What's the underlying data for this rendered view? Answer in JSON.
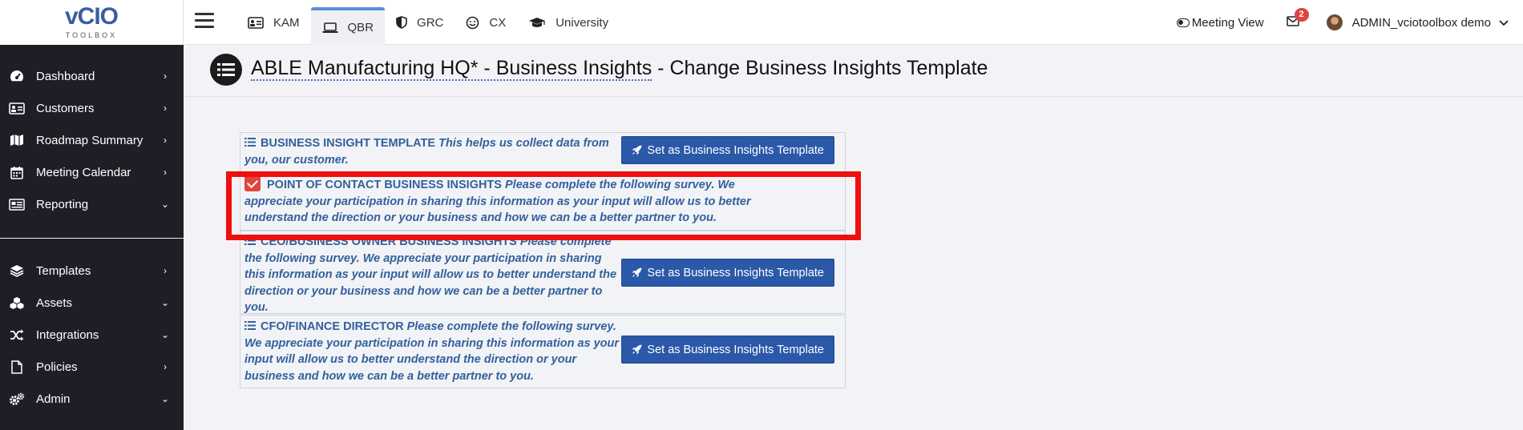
{
  "logo": {
    "main": "vCIO",
    "sub": "TOOLBOX"
  },
  "sidebar": {
    "items": [
      {
        "label": "Dashboard",
        "icon": "dashboard-icon",
        "chevron": "right"
      },
      {
        "label": "Customers",
        "icon": "id-card-icon",
        "chevron": "right"
      },
      {
        "label": "Roadmap Summary",
        "icon": "map-icon",
        "chevron": "right"
      },
      {
        "label": "Meeting Calendar",
        "icon": "calendar-icon",
        "chevron": "right"
      },
      {
        "label": "Reporting",
        "icon": "report-icon",
        "chevron": "down"
      },
      {
        "label": "Templates",
        "icon": "layers-icon",
        "chevron": "right"
      },
      {
        "label": "Assets",
        "icon": "cubes-icon",
        "chevron": "down"
      },
      {
        "label": "Integrations",
        "icon": "shuffle-icon",
        "chevron": "down"
      },
      {
        "label": "Policies",
        "icon": "file-icon",
        "chevron": "right"
      },
      {
        "label": "Admin",
        "icon": "gears-icon",
        "chevron": "down"
      }
    ]
  },
  "topbar": {
    "tabs": [
      {
        "label": "KAM",
        "icon": "id-card-icon",
        "active": false
      },
      {
        "label": "QBR",
        "icon": "laptop-icon",
        "active": true
      },
      {
        "label": "GRC",
        "icon": "shield-icon",
        "active": false
      },
      {
        "label": "CX",
        "icon": "smile-icon",
        "active": false
      },
      {
        "label": "University",
        "icon": "graduation-cap-icon",
        "active": false
      }
    ],
    "meeting_view": "Meeting View",
    "mail_badge": "2",
    "user_name": "ADMIN_vciotoolbox demo"
  },
  "page": {
    "title_link": "ABLE Manufacturing HQ* - Business Insights",
    "title_rest": " - Change Business Insights Template"
  },
  "templates": [
    {
      "name": "BUSINESS INSIGHT TEMPLATE",
      "desc": "This helps us collect data from you, our customer.",
      "button": "Set as Business Insights Template",
      "selected": false
    },
    {
      "name": "POINT OF CONTACT BUSINESS INSIGHTS",
      "desc": "Please complete the following survey. We appreciate your participation in sharing this information as your input will allow us to better understand the direction or your business and how we can be a better partner to you.",
      "button": "",
      "selected": true
    },
    {
      "name": "CEO/BUSINESS OWNER BUSINESS INSIGHTS",
      "desc": "Please complete the following survey. We appreciate your participation in sharing this information as your input will allow us to better understand the direction or your business and how we can be a better partner to you.",
      "button": "Set as Business Insights Template",
      "selected": false
    },
    {
      "name": "CFO/FINANCE DIRECTOR",
      "desc": "Please complete the following survey. We appreciate your participation in sharing this information as your input will allow us to better understand the direction or your business and how we can be a better partner to you.",
      "button": "Set as Business Insights Template",
      "selected": false
    }
  ],
  "colors": {
    "sidebar_bg": "#1e1f26",
    "accent": "#2b58a8",
    "template_text": "#34609c",
    "highlight": "#ee0f0f",
    "badge": "#e0443f"
  }
}
